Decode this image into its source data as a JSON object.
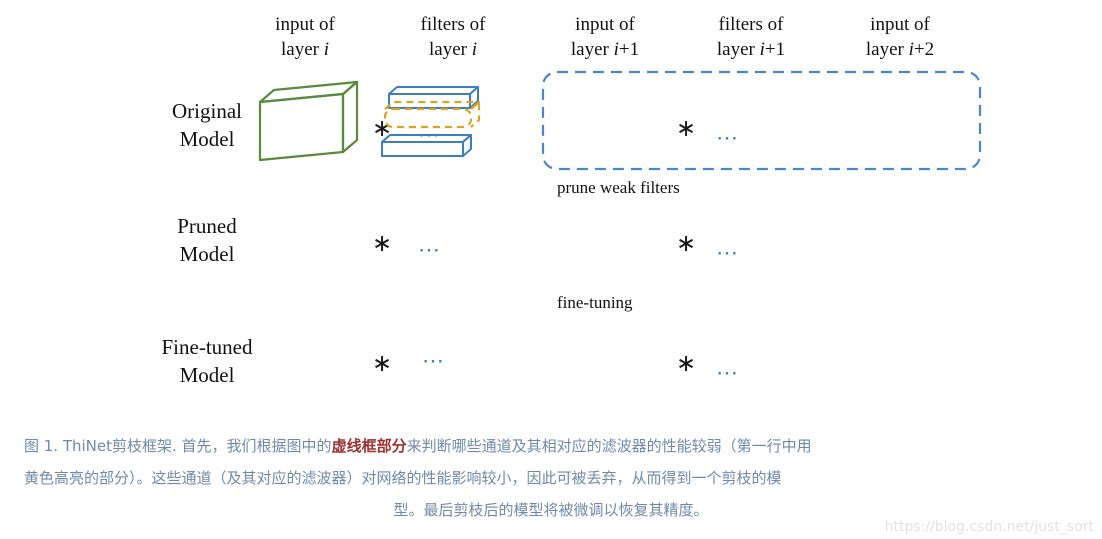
{
  "figure": {
    "column_headers": [
      {
        "line1": "input of",
        "line2_pre": "layer ",
        "line2_ital": "i",
        "line2_post": ""
      },
      {
        "line1": "filters of",
        "line2_pre": "layer ",
        "line2_ital": "i",
        "line2_post": ""
      },
      {
        "line1": "input of",
        "line2_pre": "layer ",
        "line2_ital": "i",
        "line2_post": "+1"
      },
      {
        "line1": "filters of",
        "line2_pre": "layer ",
        "line2_ital": "i",
        "line2_post": "+1"
      },
      {
        "line1": "input of",
        "line2_pre": "layer ",
        "line2_ital": "i",
        "line2_post": "+2"
      }
    ],
    "row_labels": [
      {
        "line1": "Original",
        "line2": "Model"
      },
      {
        "line1": "Pruned",
        "line2": "Model"
      },
      {
        "line1": "Fine-tuned",
        "line2": "Model"
      }
    ],
    "convolution_operator": "∗",
    "ellipsis": "⋯",
    "step_labels": [
      "prune weak filters",
      "fine-tuning"
    ],
    "colors": {
      "tensor_green": "#5a8a3c",
      "filter_blue": "#3d7ebf",
      "highlight_yellow": "#d9a521",
      "arrow_orange": "#d9601a",
      "selection_blue": "#4a86c8",
      "caption_text": "#6f8aa8",
      "caption_emphasis": "#993333",
      "watermark": "#e2e2e2"
    }
  },
  "caption": {
    "line1_a": "图 1. ThiNet剪枝框架. 首先，我们根据图中的",
    "line1_emphasis": "虚线框部分",
    "line1_b": "来判断哪些通道及其相对应的滤波器的性能较弱（第一行中用",
    "line2": "黄色高亮的部分）。这些通道（及其对应的滤波器）对网络的性能影响较小，因此可被丢弃，从而得到一个剪枝的模",
    "line3": "型。最后剪枝后的模型将被微调以恢复其精度。"
  },
  "watermark": {
    "text": "https://blog.csdn.net/just_sort"
  }
}
